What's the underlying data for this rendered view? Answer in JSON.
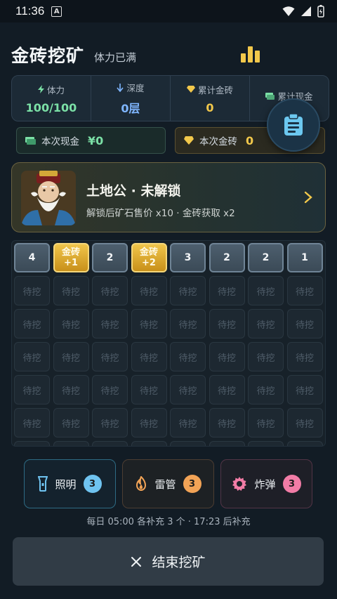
{
  "status_bar": {
    "time": "11:36",
    "notification_badge": "A"
  },
  "header": {
    "title": "金砖挖矿",
    "subtitle": "体力已满",
    "rank_icon": "bar-chart-icon"
  },
  "stats": [
    {
      "label": "体力",
      "value": "100/100",
      "color": "#7be0a6",
      "icon": "lightning-icon"
    },
    {
      "label": "深度",
      "value": "0层",
      "color": "#7fb6ff",
      "icon": "arrow-down-icon"
    },
    {
      "label": "累计金砖",
      "value": "0",
      "color": "#f2c84b",
      "icon": "diamond-icon"
    },
    {
      "label": "累计现金",
      "value": "",
      "color": "#7be0a6",
      "icon": "cash-icon"
    }
  ],
  "session": {
    "cash_label": "本次现金",
    "cash_value": "¥0",
    "gold_label": "本次金砖",
    "gold_value": "0"
  },
  "deity": {
    "name": "土地公 · 未解锁",
    "description": "解锁后矿石售价 x10 · 金砖获取 x2"
  },
  "grid": {
    "first_row": [
      {
        "type": "stone",
        "label": "4"
      },
      {
        "type": "gold",
        "label": "金砖",
        "sub": "+1"
      },
      {
        "type": "stone",
        "label": "2"
      },
      {
        "type": "gold",
        "label": "金砖",
        "sub": "+2"
      },
      {
        "type": "stone",
        "label": "3"
      },
      {
        "type": "stone",
        "label": "2"
      },
      {
        "type": "stone",
        "label": "2"
      },
      {
        "type": "stone",
        "label": "1"
      }
    ],
    "pending_label": "待挖",
    "pending_rows": 6
  },
  "tools": [
    {
      "label": "照明",
      "count": "3",
      "badge_color": "#6fc3f0",
      "icon": "flashlight-icon"
    },
    {
      "label": "雷管",
      "count": "3",
      "badge_color": "#f2a356",
      "icon": "flame-icon"
    },
    {
      "label": "炸弹",
      "count": "3",
      "badge_color": "#f27ca6",
      "icon": "gear-bomb-icon"
    }
  ],
  "refill_text": "每日 05:00 各补充 3 个 · 17:23 后补充",
  "end_button": {
    "label": "结束挖矿"
  }
}
